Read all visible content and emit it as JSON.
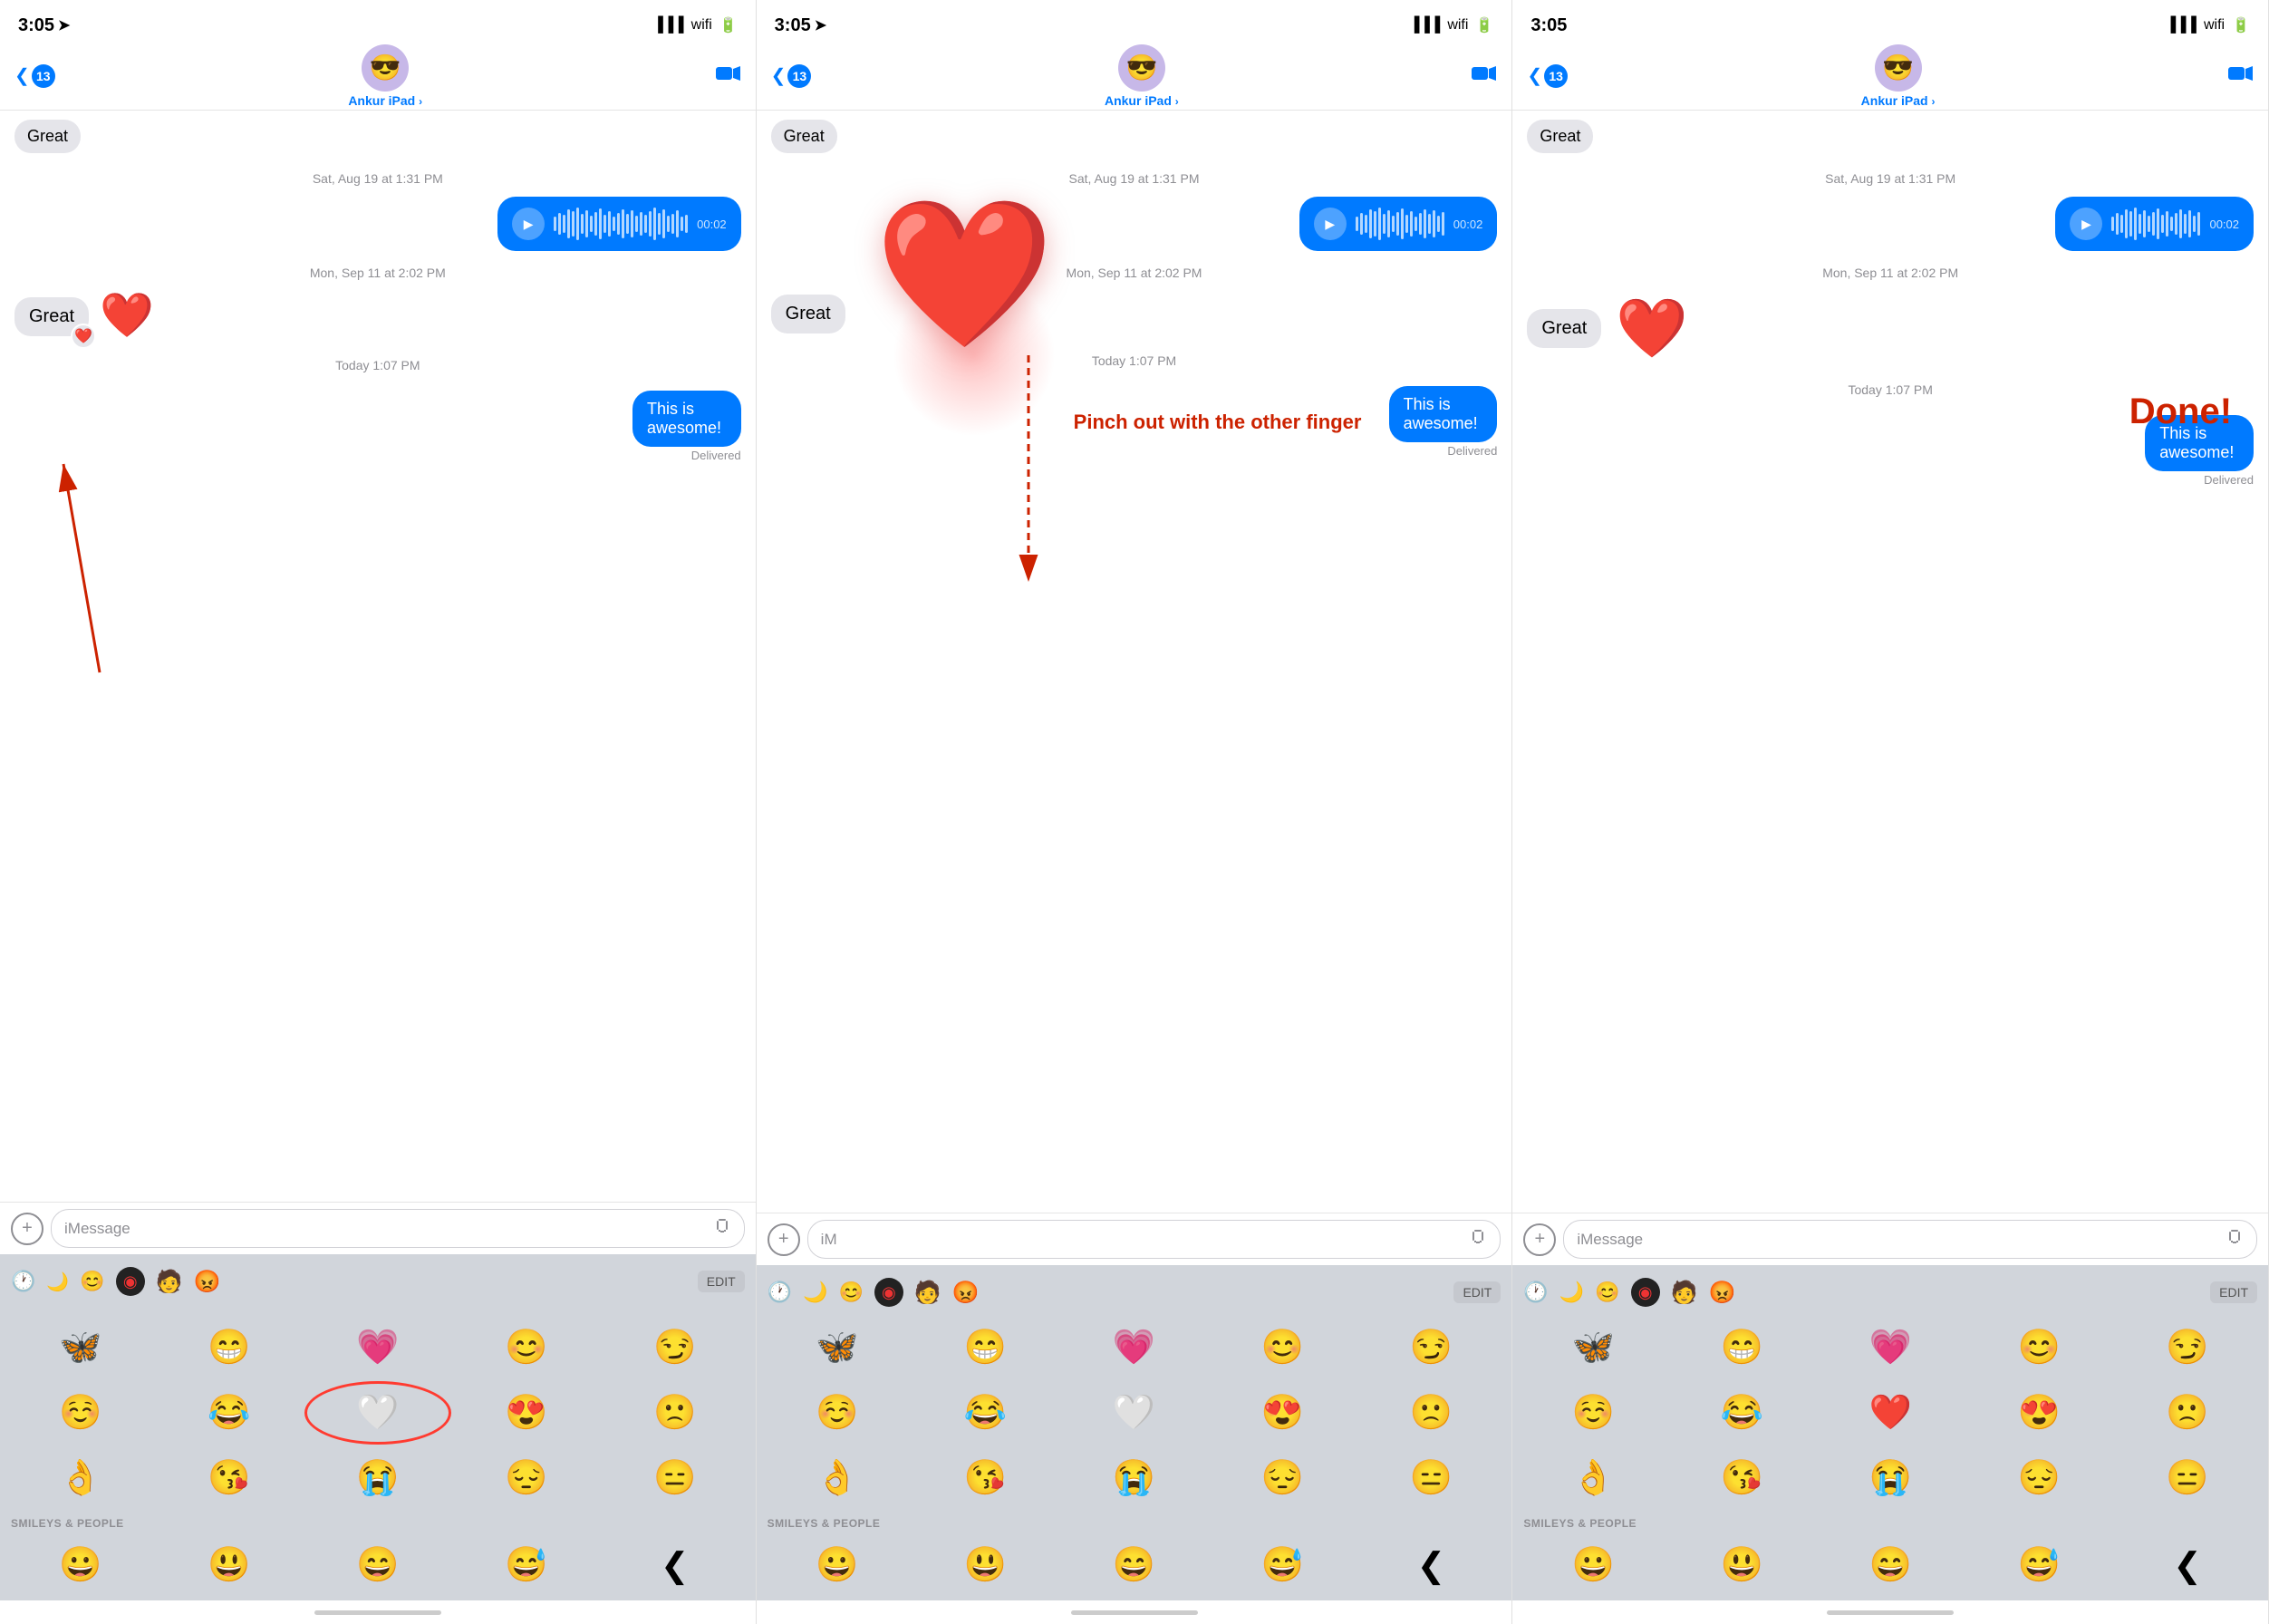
{
  "panels": [
    {
      "id": "panel1",
      "status": {
        "time": "3:05",
        "has_location": true
      },
      "nav": {
        "back_count": "13",
        "contact": "Ankur iPad",
        "has_chevron": true
      },
      "messages": {
        "great_top": "Great",
        "timestamp1": "Sat, Aug 19 at 1:31 PM",
        "voice_duration": "00:02",
        "timestamp2": "Mon, Sep 11 at 2:02 PM",
        "great_bubble": "Great",
        "timestamp3": "Today 1:07 PM",
        "awesome_msg": "This is awesome!",
        "delivered": "Delivered"
      },
      "input": {
        "placeholder": "iMessage"
      },
      "annotation": null,
      "emoji_category": "SMILEYS & PEOPLE",
      "emojis_row1": [
        "🦋",
        "😁",
        "💗",
        "😊",
        "😏"
      ],
      "emojis_row2": [
        "☺️",
        "😂",
        "🤍",
        "😍",
        "🙁"
      ],
      "emojis_row3": [
        "👌",
        "😘",
        "😭",
        "😔",
        "😑"
      ]
    },
    {
      "id": "panel2",
      "status": {
        "time": "3:05",
        "has_location": true
      },
      "nav": {
        "back_count": "13",
        "contact": "Ankur iPad",
        "has_chevron": true
      },
      "messages": {
        "great_top": "Great",
        "timestamp1": "Sat, Aug 19 at 1:31 PM",
        "voice_duration": "00:02",
        "timestamp2": "Mon, Sep 11 at 2:02 PM",
        "great_bubble": "Great",
        "timestamp3": "Today 1:07 PM",
        "awesome_msg": "This is awesome!",
        "delivered": "Delivered"
      },
      "input": {
        "placeholder": "iM"
      },
      "annotation": {
        "pinch_text": "Pinch out with\nthe other finger"
      },
      "emoji_category": "SMILEYS & PEOPLE",
      "emojis_row1": [
        "🦋",
        "😁",
        "💗",
        "😊",
        "😏"
      ],
      "emojis_row2": [
        "☺️",
        "😂",
        "🤍",
        "😍",
        "🙁"
      ],
      "emojis_row3": [
        "👌",
        "😘",
        "😭",
        "😔",
        "😑"
      ]
    },
    {
      "id": "panel3",
      "status": {
        "time": "3:05",
        "has_location": false
      },
      "nav": {
        "back_count": "13",
        "contact": "Ankur iPad",
        "has_chevron": true
      },
      "messages": {
        "great_top": "Great",
        "timestamp1": "Sat, Aug 19 at 1:31 PM",
        "voice_duration": "00:02",
        "timestamp2": "Mon, Sep 11 at 2:02 PM",
        "great_bubble": "Great",
        "timestamp3": "Today 1:07 PM",
        "awesome_msg": "This is awesome!",
        "delivered": "Delivered"
      },
      "input": {
        "placeholder": "iMessage"
      },
      "annotation": {
        "done_text": "Done!"
      },
      "emoji_category": "SMILEYS & PEOPLE",
      "emojis_row1": [
        "🦋",
        "😁",
        "💗",
        "😊",
        "😏"
      ],
      "emojis_row2": [
        "☺️",
        "😂",
        "❤️",
        "😍",
        "🙁"
      ],
      "emojis_row3": [
        "👌",
        "😘",
        "😭",
        "😔",
        "😑"
      ]
    }
  ],
  "icons": {
    "play": "▶",
    "plus": "+",
    "mic": "📶",
    "back_chevron": "❮",
    "video": "📷",
    "clock": "🕐",
    "moon": "🌙",
    "smiley": "😊",
    "disk": "💿",
    "people": "👥",
    "face_red": "😡",
    "edit": "EDIT"
  }
}
